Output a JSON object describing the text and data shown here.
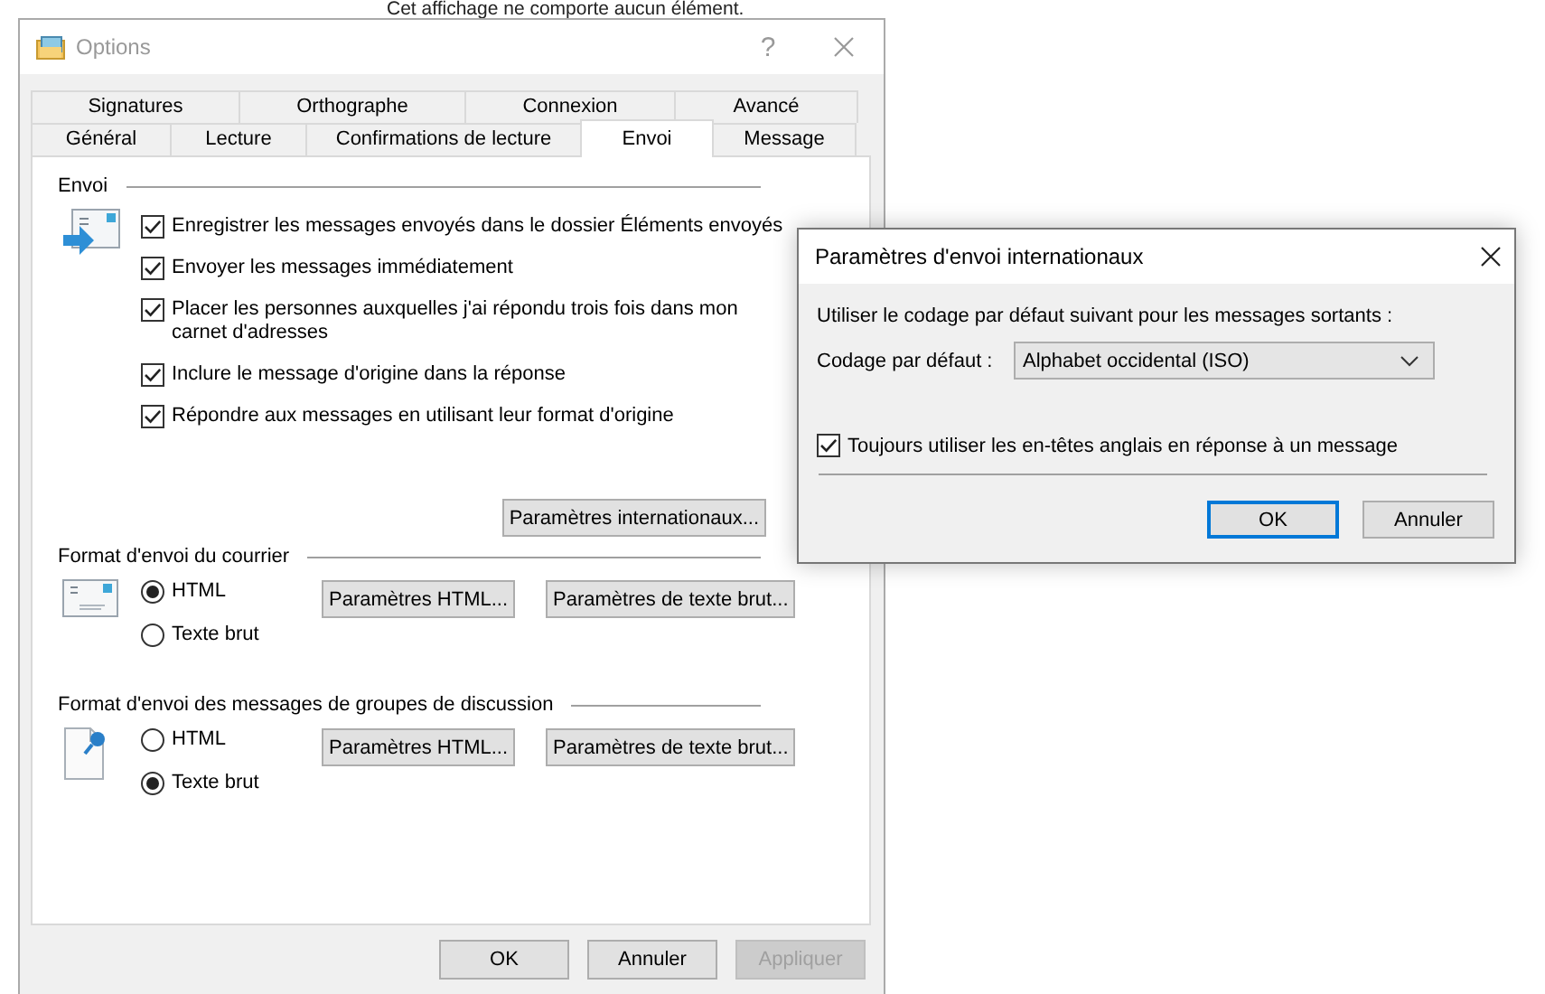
{
  "background_message": "Cet affichage ne comporte aucun élément.",
  "options_window": {
    "title": "Options",
    "help": "?",
    "tab_rows": [
      [
        {
          "label": "Signatures",
          "selected": false
        },
        {
          "label": "Orthographe",
          "selected": false
        },
        {
          "label": "Connexion",
          "selected": false
        },
        {
          "label": "Avancé",
          "selected": false
        }
      ],
      [
        {
          "label": "Général",
          "selected": false
        },
        {
          "label": "Lecture",
          "selected": false
        },
        {
          "label": "Confirmations de lecture",
          "selected": false
        },
        {
          "label": "Envoi",
          "selected": true
        },
        {
          "label": "Message",
          "selected": false
        }
      ]
    ],
    "sections": [
      {
        "kind": "send",
        "title": "Envoi",
        "checkboxes": [
          {
            "label": "Enregistrer les messages envoyés dans le dossier Éléments envoyés",
            "checked": true
          },
          {
            "label": "Envoyer les messages immédiatement",
            "checked": true
          },
          {
            "label": "Placer les personnes auxquelles j'ai répondu trois fois dans mon carnet d'adresses",
            "checked": true
          },
          {
            "label": "Inclure le message d'origine dans la réponse",
            "checked": true
          },
          {
            "label": "Répondre aux messages en utilisant leur format d'origine",
            "checked": true
          }
        ],
        "buttons": [
          "Paramètres internationaux..."
        ]
      },
      {
        "kind": "mail_format",
        "title": "Format d'envoi du courrier",
        "radios": [
          {
            "label": "HTML",
            "selected": true
          },
          {
            "label": "Texte brut",
            "selected": false
          }
        ],
        "buttons": [
          "Paramètres HTML...",
          "Paramètres de texte brut..."
        ]
      },
      {
        "kind": "news_format",
        "title": "Format d'envoi des messages de groupes de discussion",
        "radios": [
          {
            "label": "HTML",
            "selected": false
          },
          {
            "label": "Texte brut",
            "selected": true
          }
        ],
        "buttons": [
          "Paramètres HTML...",
          "Paramètres de texte brut..."
        ]
      }
    ],
    "buttons": [
      {
        "label": "OK",
        "disabled": false
      },
      {
        "label": "Annuler",
        "disabled": false
      },
      {
        "label": "Appliquer",
        "disabled": true
      }
    ]
  },
  "international_dialog": {
    "title": "Paramètres d'envoi internationaux",
    "intro": "Utiliser le codage par défaut suivant pour les messages sortants :",
    "encoding_label": "Codage par défaut :",
    "encoding_value": "Alphabet occidental (ISO)",
    "checkbox": {
      "label": "Toujours utiliser les en-têtes anglais en réponse à un message",
      "checked": true
    },
    "buttons": [
      {
        "label": "OK",
        "default": true
      },
      {
        "label": "Annuler",
        "default": false
      }
    ]
  }
}
